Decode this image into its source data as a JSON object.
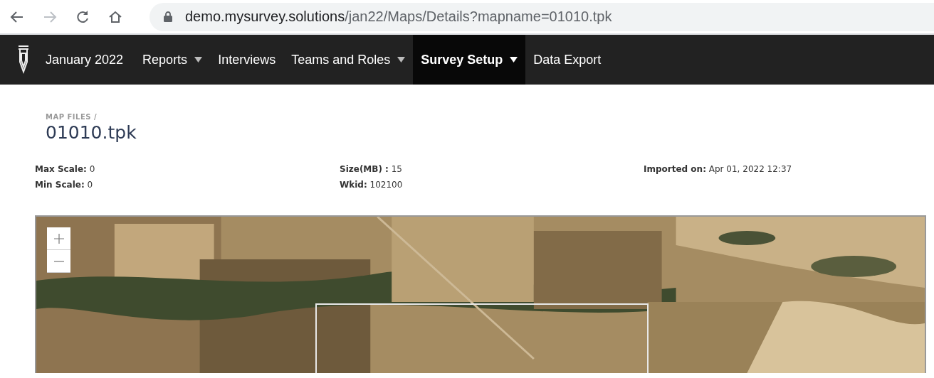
{
  "browser": {
    "address": {
      "host": "demo.mysurvey.solutions",
      "path": "/jan22/Maps/Details?mapname=01010.tpk"
    },
    "forward_disabled": true
  },
  "nav": {
    "brand": "January 2022",
    "items": [
      {
        "label": "Reports",
        "has_menu": true,
        "selected": false
      },
      {
        "label": "Interviews",
        "has_menu": false,
        "selected": false
      },
      {
        "label": "Teams and Roles",
        "has_menu": true,
        "selected": false
      },
      {
        "label": "Survey Setup",
        "has_menu": true,
        "selected": true
      },
      {
        "label": "Data Export",
        "has_menu": false,
        "selected": false
      }
    ]
  },
  "breadcrumb": "MAP FILES /",
  "title": "01010.tpk",
  "details": [
    [
      {
        "label": "Max Scale:",
        "value": "0"
      },
      {
        "label": "Min Scale:",
        "value": "0"
      }
    ],
    [
      {
        "label": "Size(MB) :",
        "value": "15"
      },
      {
        "label": "Wkid:",
        "value": "102100"
      }
    ],
    [
      {
        "label": "Imported on:",
        "value": "Apr 01, 2022 12:37"
      }
    ]
  ],
  "map": {
    "kind": "picture"
  }
}
